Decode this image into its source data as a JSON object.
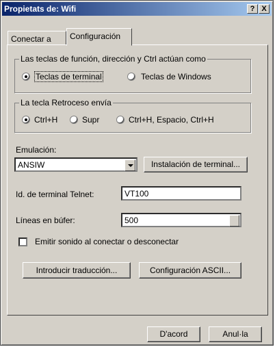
{
  "window": {
    "title": "Propietats de: Wifi",
    "help_label": "?",
    "close_label": "X"
  },
  "tabs": [
    {
      "label": "Conectar a"
    },
    {
      "label": "Configuración",
      "selected": true
    }
  ],
  "group_keys": {
    "label": "Las teclas de función, dirección y Ctrl actúan como",
    "options": [
      {
        "label": "Teclas de terminal",
        "selected": true
      },
      {
        "label": "Teclas de Windows",
        "selected": false
      }
    ]
  },
  "group_backspace": {
    "label": "La tecla Retroceso envía",
    "options": [
      {
        "label": "Ctrl+H",
        "selected": true
      },
      {
        "label": "Supr",
        "selected": false
      },
      {
        "label": "Ctrl+H, Espacio, Ctrl+H",
        "selected": false
      }
    ]
  },
  "emulation": {
    "label": "Emulación:",
    "value": "ANSIW",
    "setup_button": "Instalación de terminal..."
  },
  "telnet": {
    "label": "Id. de terminal Telnet:",
    "value": "VT100"
  },
  "buffer": {
    "label": "Líneas en búfer:",
    "value": "500"
  },
  "sound": {
    "label": "Emitir sonido al conectar o desconectar",
    "checked": false
  },
  "buttons": {
    "translation": "Introducir traducción...",
    "ascii": "Configuración ASCII...",
    "ok": "D'acord",
    "cancel": "Anul·la"
  }
}
